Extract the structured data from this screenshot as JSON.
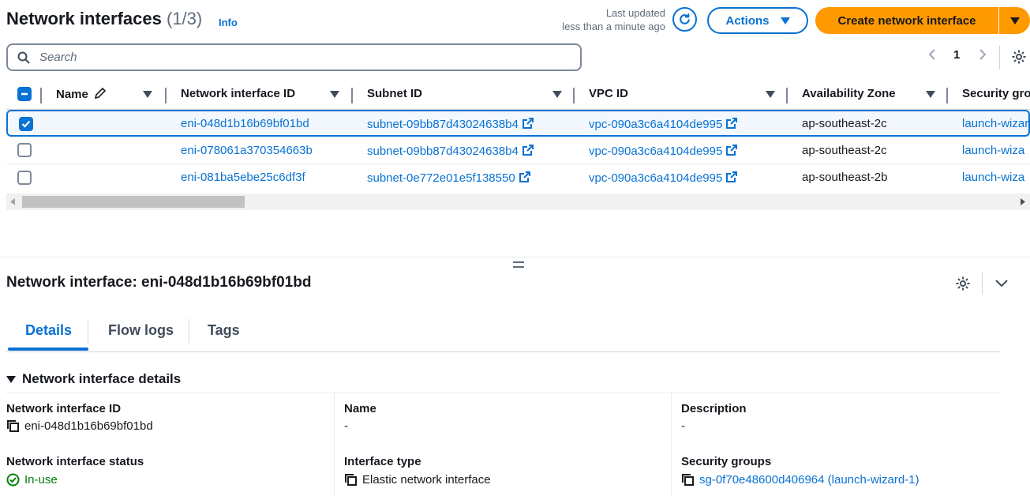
{
  "header": {
    "title": "Network interfaces",
    "count": "(1/3)",
    "info": "Info",
    "last_updated_label": "Last updated",
    "last_updated_value": "less than a minute ago",
    "actions_label": "Actions",
    "create_label": "Create network interface"
  },
  "search": {
    "placeholder": "Search"
  },
  "pagination": {
    "current_page": "1"
  },
  "table": {
    "columns": [
      "Name",
      "Network interface ID",
      "Subnet ID",
      "VPC ID",
      "Availability Zone",
      "Security gro"
    ],
    "rows": [
      {
        "selected": true,
        "name": "",
        "eni": "eni-048d1b16b69bf01bd",
        "subnet": "subnet-09bb87d43024638b4",
        "vpc": "vpc-090a3c6a4104de995",
        "az": "ap-southeast-2c",
        "sg": "launch-wizar"
      },
      {
        "selected": false,
        "name": "",
        "eni": "eni-078061a370354663b",
        "subnet": "subnet-09bb87d43024638b4",
        "vpc": "vpc-090a3c6a4104de995",
        "az": "ap-southeast-2c",
        "sg": "launch-wiza"
      },
      {
        "selected": false,
        "name": "",
        "eni": "eni-081ba5ebe25c6df3f",
        "subnet": "subnet-0e772e01e5f138550",
        "vpc": "vpc-090a3c6a4104de995",
        "az": "ap-southeast-2b",
        "sg": "launch-wiza"
      }
    ]
  },
  "panel": {
    "title": "Network interface: eni-048d1b16b69bf01bd",
    "tabs": [
      "Details",
      "Flow logs",
      "Tags"
    ],
    "section_title": "Network interface details",
    "fields": {
      "eni_label": "Network interface ID",
      "eni_value": "eni-048d1b16b69bf01bd",
      "name_label": "Name",
      "name_value": "-",
      "description_label": "Description",
      "description_value": "-",
      "status_label": "Network interface status",
      "status_value": "In-use",
      "type_label": "Interface type",
      "type_value": "Elastic network interface",
      "sg_label": "Security groups",
      "sg_value": "sg-0f70e48600d406964 (launch-wizard-1)"
    }
  },
  "colors": {
    "accent": "#0972d3",
    "primary_button": "#ff9900",
    "success": "#037f0c"
  }
}
